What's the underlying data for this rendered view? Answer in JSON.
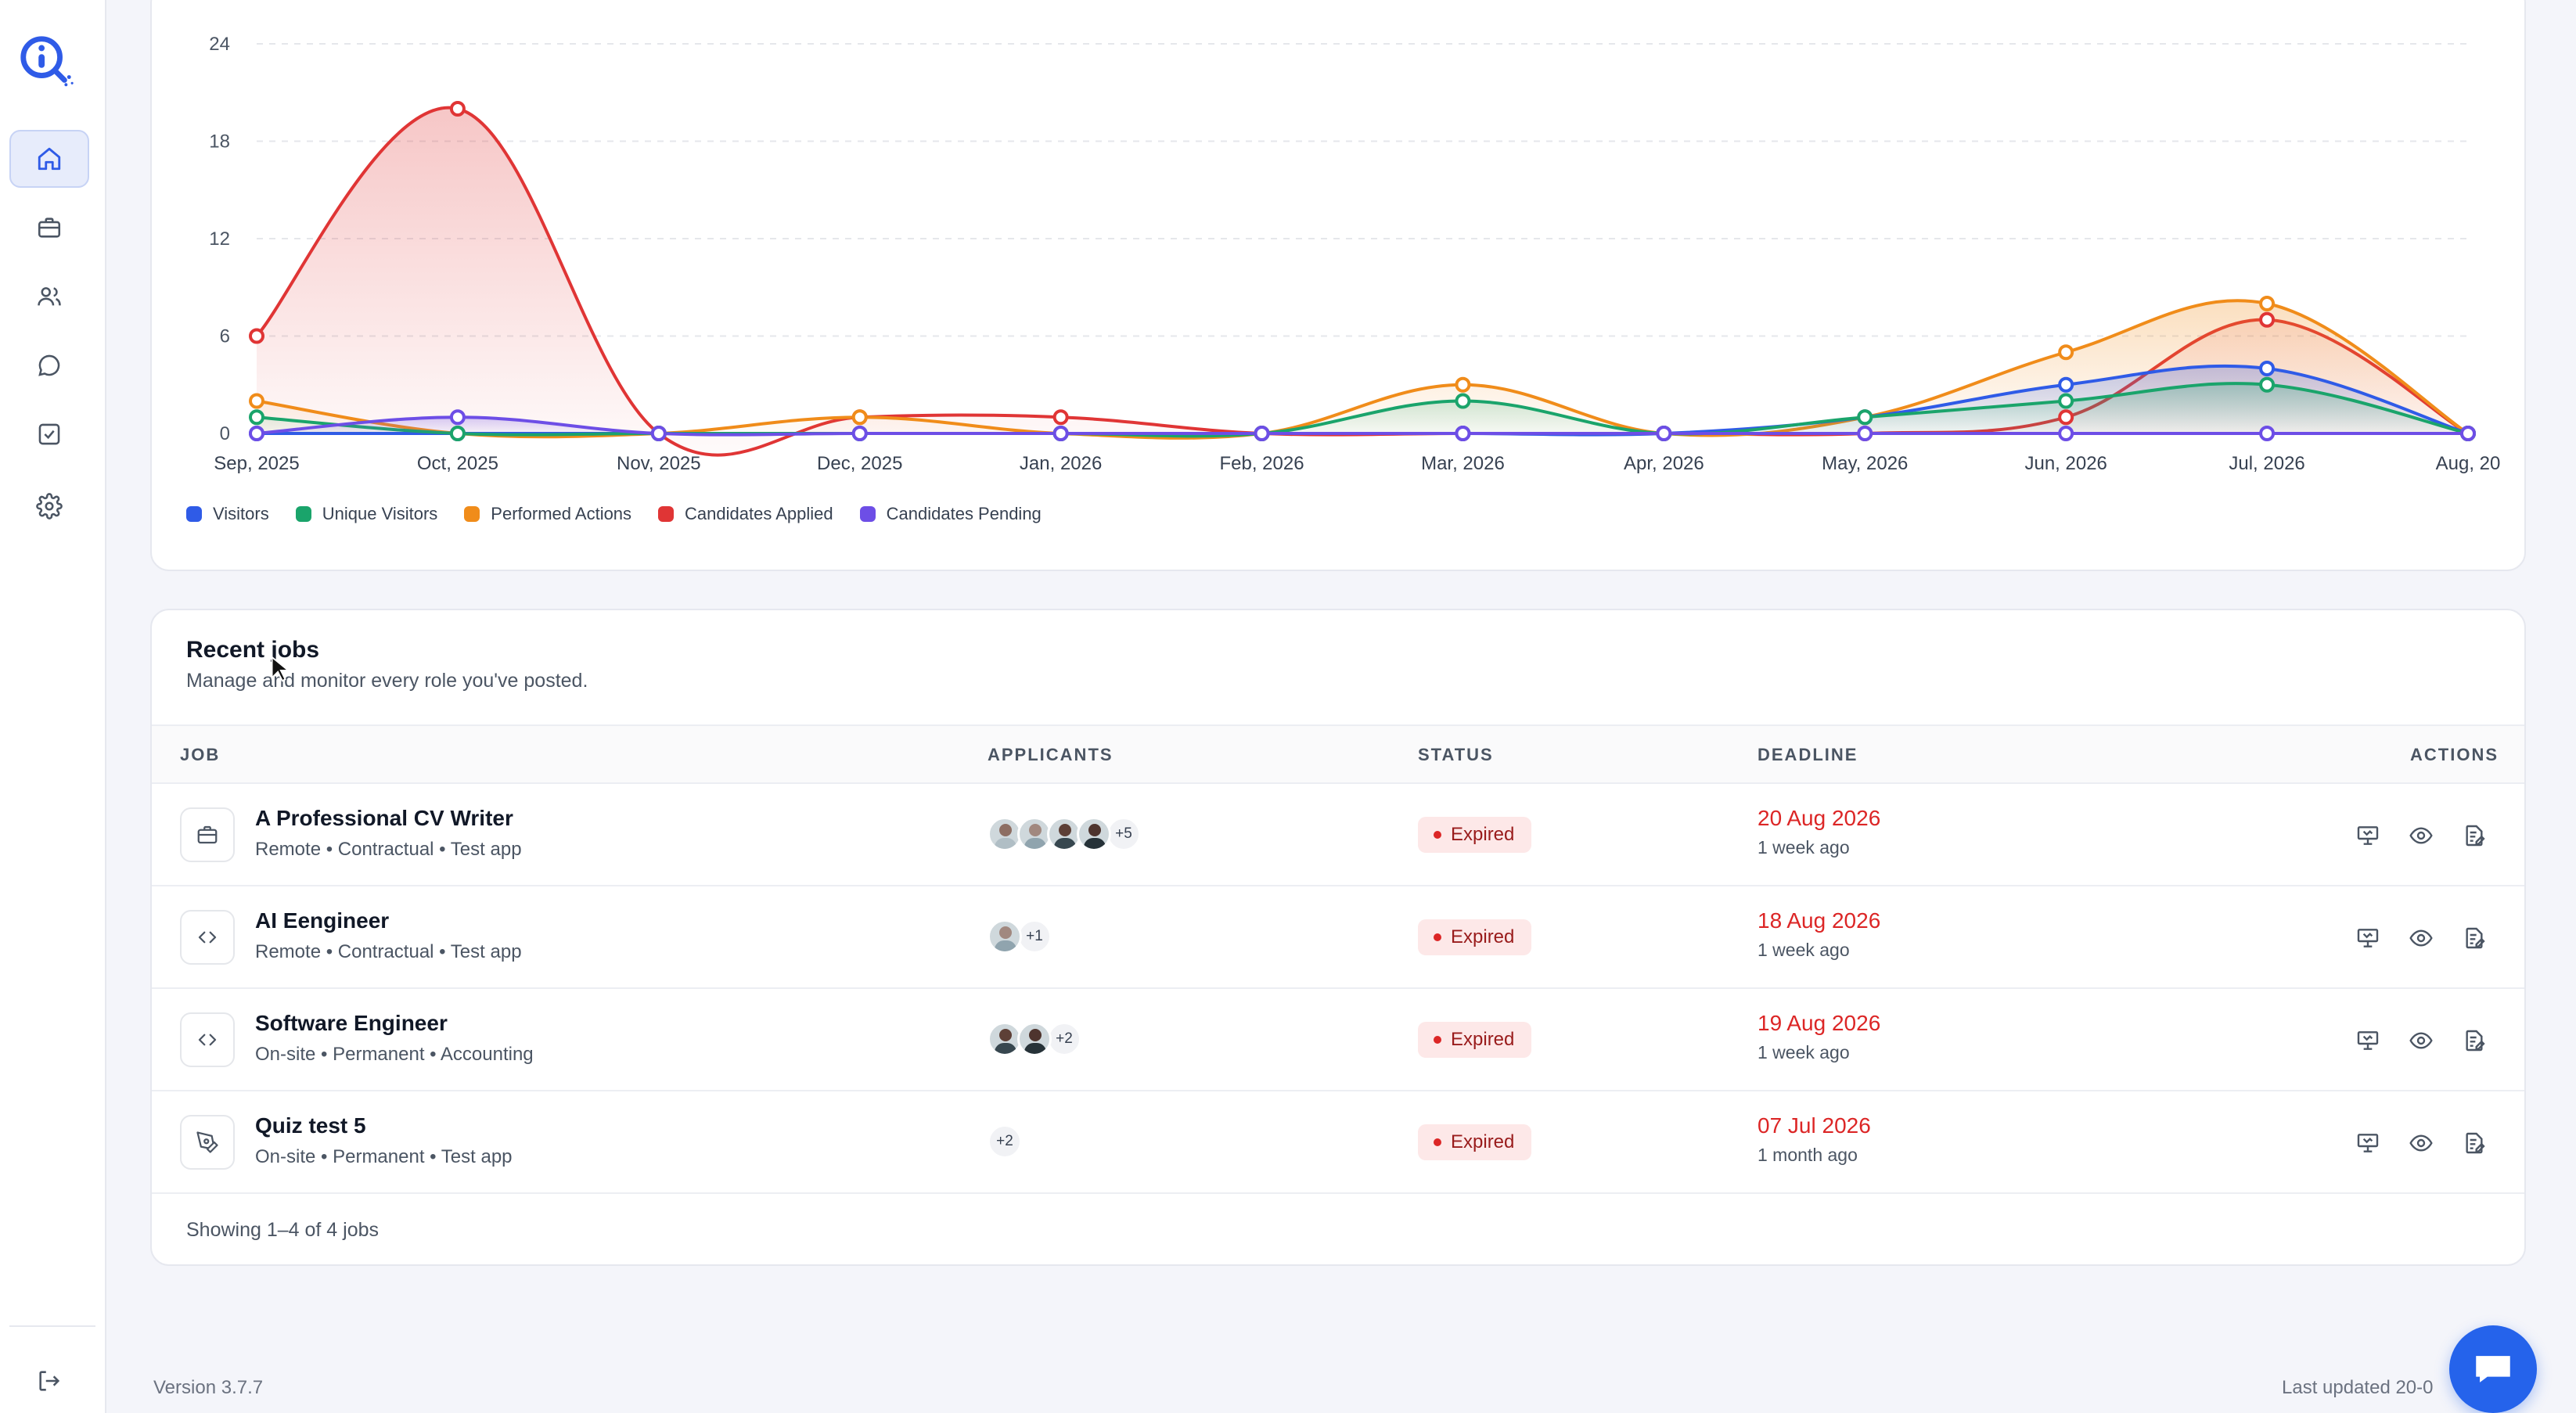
{
  "sidebar": {
    "items": [
      {
        "icon": "home-icon",
        "active": true
      },
      {
        "icon": "briefcase-icon",
        "active": false
      },
      {
        "icon": "users-icon",
        "active": false
      },
      {
        "icon": "chat-icon",
        "active": false
      },
      {
        "icon": "checkbox-icon",
        "active": false
      },
      {
        "icon": "settings-icon",
        "active": false
      }
    ],
    "logout_icon": "logout-icon"
  },
  "chart_data": {
    "type": "line",
    "categories": [
      "Sep, 2025",
      "Oct, 2025",
      "Nov, 2025",
      "Dec, 2025",
      "Jan, 2026",
      "Feb, 2026",
      "Mar, 2026",
      "Apr, 2026",
      "May, 2026",
      "Jun, 2026",
      "Jul, 2026",
      "Aug, 20"
    ],
    "ylim": [
      0,
      24
    ],
    "yticks": [
      "0",
      "6",
      "12",
      "18",
      "24"
    ],
    "grid": true,
    "legend_position": "bottom-left",
    "series": [
      {
        "name": "Visitors",
        "color": "#2f5be7",
        "values": [
          0,
          0,
          0,
          0,
          0,
          0,
          0,
          0,
          1,
          3,
          4,
          0
        ]
      },
      {
        "name": "Unique Visitors",
        "color": "#1aa46b",
        "values": [
          1,
          0,
          0,
          0,
          0,
          0,
          2,
          0,
          1,
          2,
          3,
          0
        ]
      },
      {
        "name": "Performed Actions",
        "color": "#f08c1a",
        "values": [
          2,
          0,
          0,
          1,
          0,
          0,
          3,
          0,
          1,
          5,
          8,
          0
        ]
      },
      {
        "name": "Candidates Applied",
        "color": "#e03535",
        "values": [
          6,
          20,
          0,
          1,
          1,
          0,
          0,
          0,
          0,
          1,
          7,
          0
        ]
      },
      {
        "name": "Candidates Pending",
        "color": "#6d4ee6",
        "values": [
          0,
          1,
          0,
          0,
          0,
          0,
          0,
          0,
          0,
          0,
          0,
          0
        ]
      }
    ]
  },
  "jobs": {
    "title": "Recent jobs",
    "subtitle": "Manage and monitor every role you've posted.",
    "columns": [
      "JOB",
      "APPLICANTS",
      "STATUS",
      "DEADLINE",
      "ACTIONS"
    ],
    "rows": [
      {
        "icon": "briefcase-icon",
        "title": "A Professional CV Writer",
        "meta": "Remote • Contractual • Test app",
        "avatars": 4,
        "more": "+5",
        "status": "Expired",
        "deadline": "20 Aug 2026",
        "relative": "1 week ago"
      },
      {
        "icon": "code-icon",
        "title": "AI Eengineer",
        "meta": "Remote • Contractual • Test app",
        "avatars": 1,
        "more": "+1",
        "status": "Expired",
        "deadline": "18 Aug 2026",
        "relative": "1 week ago"
      },
      {
        "icon": "code-icon",
        "title": "Software Engineer",
        "meta": "On-site • Permanent • Accounting",
        "avatars": 2,
        "more": "+2",
        "status": "Expired",
        "deadline": "19 Aug 2026",
        "relative": "1 week ago"
      },
      {
        "icon": "pen-tool-icon",
        "title": "Quiz test 5",
        "meta": "On-site • Permanent • Test app",
        "avatars": 0,
        "more": "+2",
        "status": "Expired",
        "deadline": "07 Jul 2026",
        "relative": "1 month ago"
      }
    ],
    "footer": "Showing 1–4 of 4 jobs"
  },
  "footer": {
    "version": "Version 3.7.7",
    "updated": "Last updated 20-0"
  },
  "colors": {
    "accent": "#2563eb",
    "expired_text": "#991b1b",
    "expired_bg": "#fde8e8",
    "deadline": "#dc2626"
  }
}
